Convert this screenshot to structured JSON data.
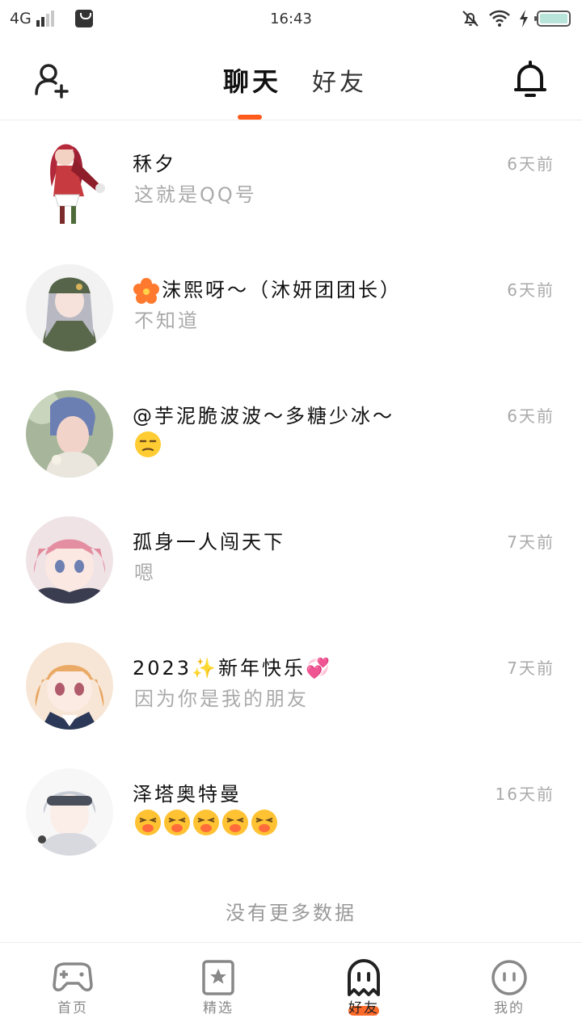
{
  "status_bar": {
    "network": "4G",
    "time": "16:43"
  },
  "header": {
    "tabs": [
      {
        "label": "聊天",
        "active": true
      },
      {
        "label": "好友",
        "active": false
      }
    ],
    "icons": {
      "left": "add-user-icon",
      "right": "bell-icon"
    },
    "accent": "#ff5b1a"
  },
  "conversations": [
    {
      "name": "秝夕",
      "message": "这就是QQ号",
      "time": "6天前",
      "avatar_color": "#c23b3b"
    },
    {
      "name": "沫熙呀～（沐妍团团长）",
      "name_prefix_emoji": "hibiscus",
      "message": "不知道",
      "time": "6天前",
      "avatar_color": "#7c8a5e"
    },
    {
      "name": "@芋泥脆波波～多糖少冰～",
      "message": "😒",
      "time": "6天前",
      "avatar_color": "#8aa6b8"
    },
    {
      "name": "孤身一人闯天下",
      "message": "嗯",
      "time": "7天前",
      "avatar_color": "#e79aa8"
    },
    {
      "name": "2023✨新年快乐💞",
      "message": "因为你是我的朋友",
      "time": "7天前",
      "avatar_color": "#e4a264"
    },
    {
      "name": "泽塔奥特曼",
      "message": "😫😫😫😫😫",
      "time": "16天前",
      "avatar_color": "#b9c0c8"
    }
  ],
  "footer_text": "没有更多数据",
  "bottom_nav": [
    {
      "label": "首页",
      "icon": "gamepad-icon",
      "active": false
    },
    {
      "label": "精选",
      "icon": "star-bookmark-icon",
      "active": false
    },
    {
      "label": "好友",
      "icon": "ghost-icon",
      "active": true
    },
    {
      "label": "我的",
      "icon": "face-icon",
      "active": false
    }
  ]
}
